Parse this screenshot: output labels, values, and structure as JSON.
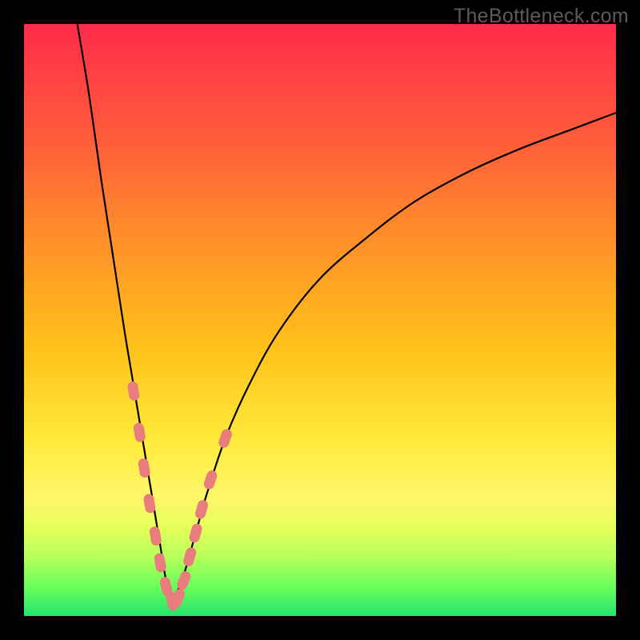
{
  "watermark": "TheBottleneck.com",
  "colors": {
    "frame": "#000000",
    "marker": "#e97d7d",
    "curve": "#000000",
    "gradient_stops": [
      "#ff2b4a",
      "#ff5e3a",
      "#ff8c2a",
      "#ffc21a",
      "#ffe93a",
      "#fff76a",
      "#e6ff5a",
      "#b7ff5a",
      "#6aff5a",
      "#25e36e"
    ]
  },
  "chart_data": {
    "type": "line",
    "title": "",
    "xlabel": "",
    "ylabel": "",
    "xlim": [
      0,
      100
    ],
    "ylim": [
      0,
      100
    ],
    "note": "Bottleneck-style V-curve; two branches meeting at a minimum near x≈25. Values estimated from pixel positions (no axis ticks visible).",
    "series": [
      {
        "name": "left-branch",
        "x": [
          9,
          11,
          13,
          15,
          17,
          18,
          19,
          20,
          21,
          22,
          23,
          24,
          25
        ],
        "y": [
          100,
          88,
          74,
          61,
          48,
          42,
          36,
          30,
          24,
          18,
          12,
          6,
          2
        ]
      },
      {
        "name": "right-branch",
        "x": [
          25,
          27,
          29,
          31,
          34,
          38,
          43,
          50,
          58,
          66,
          75,
          84,
          92,
          100
        ],
        "y": [
          2,
          7,
          14,
          21,
          30,
          39,
          48,
          57,
          64,
          70,
          75,
          79,
          82,
          85
        ]
      }
    ],
    "markers": {
      "name": "highlighted-points",
      "shape": "rounded-pill",
      "note": "Salmon capsule markers clustered around the valley; estimated centers.",
      "points": [
        {
          "x": 18.5,
          "y": 38
        },
        {
          "x": 19.5,
          "y": 31
        },
        {
          "x": 20.3,
          "y": 25
        },
        {
          "x": 21.2,
          "y": 19
        },
        {
          "x": 22.2,
          "y": 13.5
        },
        {
          "x": 23.0,
          "y": 9
        },
        {
          "x": 24.0,
          "y": 5
        },
        {
          "x": 25.0,
          "y": 2.5
        },
        {
          "x": 26.0,
          "y": 3
        },
        {
          "x": 27.0,
          "y": 6
        },
        {
          "x": 28.0,
          "y": 10
        },
        {
          "x": 29.0,
          "y": 14
        },
        {
          "x": 30.0,
          "y": 18
        },
        {
          "x": 31.5,
          "y": 23
        },
        {
          "x": 34.0,
          "y": 30
        }
      ]
    }
  }
}
